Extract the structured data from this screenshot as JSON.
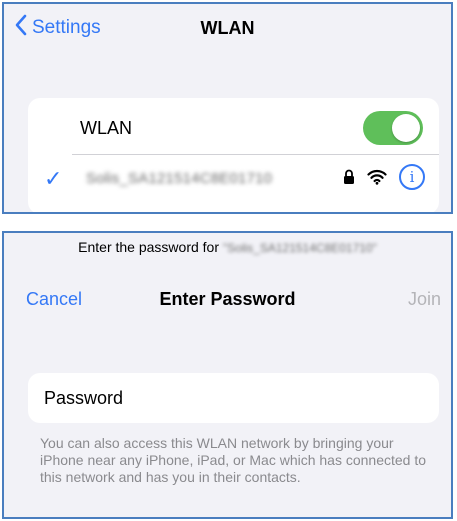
{
  "settings_screen": {
    "back_label": "Settings",
    "title": "WLAN",
    "wlan_toggle_label": "WLAN",
    "wlan_enabled": true,
    "network": {
      "name": "Solis_SA121514C8E01710",
      "selected": true,
      "secured": true
    },
    "icons": [
      "chevron-left-icon",
      "checkmark-icon",
      "lock-icon",
      "wifi-icon",
      "info-icon"
    ],
    "colors": {
      "accent": "#3478f6",
      "toggle_on": "#5fbf5a"
    }
  },
  "password_screen": {
    "prompt_prefix": "Enter the password for",
    "prompt_network": "\"Solis_SA121514C8E01710\"",
    "cancel_label": "Cancel",
    "title": "Enter Password",
    "join_label": "Join",
    "password_placeholder": "Password",
    "helper_text": "You can also access this WLAN network by bringing your iPhone near any iPhone, iPad, or Mac which has connected to this network and has you in their contacts."
  }
}
